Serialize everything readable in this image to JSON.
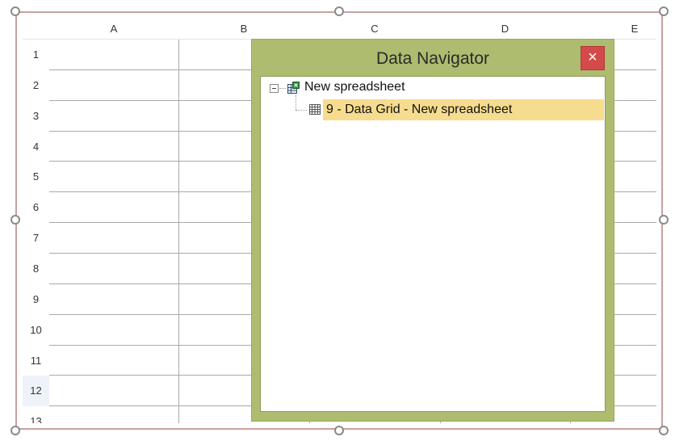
{
  "spreadsheet": {
    "columns": [
      "A",
      "B",
      "C",
      "D",
      "E"
    ],
    "rows": [
      "1",
      "2",
      "3",
      "4",
      "5",
      "6",
      "7",
      "8",
      "9",
      "10",
      "11",
      "12",
      "13"
    ],
    "selected_row": "12"
  },
  "dialog": {
    "title": "Data Navigator",
    "close_label": "×",
    "tree": {
      "root_label": "New spreadsheet",
      "root_icon": "spreadsheet-icon",
      "child_label": "9 - Data Grid - New spreadsheet",
      "child_icon": "data-grid-icon"
    },
    "colors": {
      "dialog_bg": "#adbc6f",
      "close_bg": "#d44a4a",
      "selection_bg": "#f6dc8e"
    }
  }
}
